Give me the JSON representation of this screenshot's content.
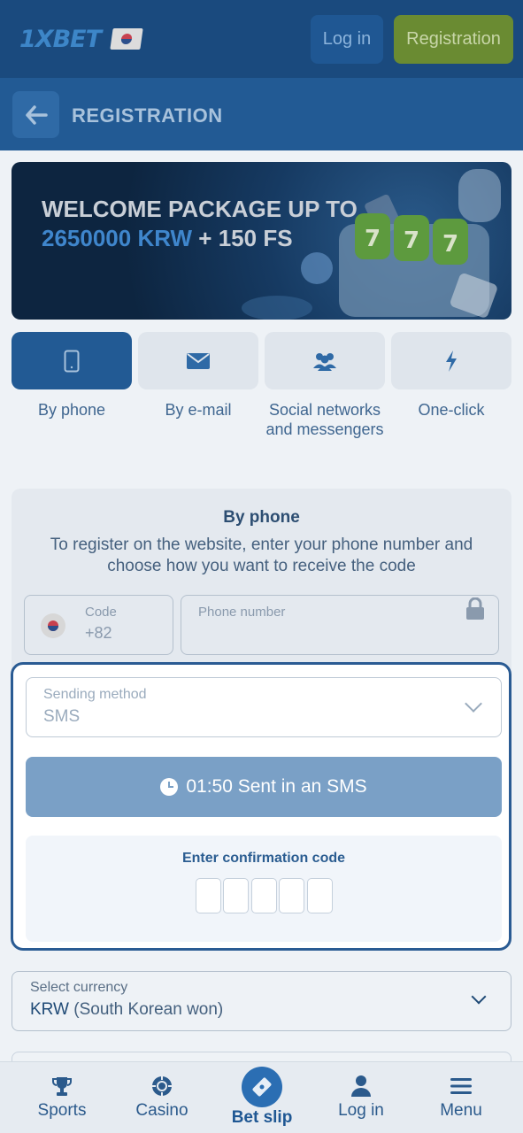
{
  "header": {
    "logo_text": "1XBET",
    "login_label": "Log in",
    "registration_label": "Registration"
  },
  "reg_bar": {
    "title": "REGISTRATION"
  },
  "banner": {
    "line1": "WELCOME PACKAGE UP TO",
    "amount": "2650000 KRW",
    "bonus": " + 150 FS"
  },
  "tabs": [
    {
      "label": "By phone",
      "icon": "phone-icon",
      "active": true
    },
    {
      "label": "By e-mail",
      "icon": "envelope-icon",
      "active": false
    },
    {
      "label": "Social networks and messengers",
      "icon": "people-icon",
      "active": false
    },
    {
      "label": "One-click",
      "icon": "lightning-icon",
      "active": false
    }
  ],
  "form": {
    "title": "By phone",
    "description": "To register on the website, enter your phone number and choose how you want to receive the code",
    "code_label": "Code",
    "code_value": "+82",
    "phone_placeholder": "Phone number"
  },
  "sms_panel": {
    "sending_method_label": "Sending method",
    "sending_method_value": "SMS",
    "timer_text": "01:50 Sent in an SMS",
    "confirm_title": "Enter confirmation code",
    "code_cells": 5
  },
  "currency": {
    "label": "Select currency",
    "code": "KRW",
    "name": "(South Korean won)"
  },
  "bottom_nav": [
    {
      "label": "Sports",
      "icon": "trophy-icon"
    },
    {
      "label": "Casino",
      "icon": "casino-chip-icon"
    },
    {
      "label": "Bet slip",
      "icon": "ticket-icon"
    },
    {
      "label": "Log in",
      "icon": "user-icon"
    },
    {
      "label": "Menu",
      "icon": "hamburger-menu-icon"
    }
  ],
  "colors": {
    "header_bg": "#1a4a7e",
    "accent_blue": "#225a94",
    "registration_green": "#6a8b32",
    "timer_button": "#7aa0c6"
  }
}
